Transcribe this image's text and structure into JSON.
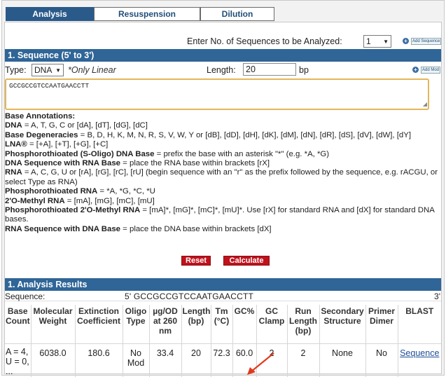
{
  "tabs": [
    {
      "label": "Analysis"
    },
    {
      "label": "Resuspension"
    },
    {
      "label": "Dilution"
    }
  ],
  "seq_count": {
    "label": "Enter No. of Sequences to be Analyzed:",
    "value": "1",
    "add_label": "Add Sequence"
  },
  "section1": {
    "title": "1. Sequence (5' to 3')"
  },
  "type_row": {
    "label": "Type:",
    "value": "DNA",
    "note": "*Only Linear",
    "length_label": "Length:",
    "length_value": "20",
    "unit": "bp",
    "add_mod_label": "Add Mod"
  },
  "sequence_input": "GCCGCCGTCCAATGAACCTT",
  "annotations": {
    "base_title": "Base Annotations:",
    "dna_k": "DNA",
    "dna_v": " = A, T, G, C or [dA], [dT], [dG], [dC]",
    "degen_k": "Base Degeneracies",
    "degen_v": " = B, D, H, K, M, N, R, S, V, W, Y or [dB], [dD], [dH], [dK], [dM], [dN], [dR], [dS], [dV], [dW], [dY]",
    "lna_k": "LNA®",
    "lna_v": " = [+A], [+T], [+G], [+C]",
    "ps_k": "Phosphorothioated (S-Oligo) DNA Base",
    "ps_v": " = prefix the base with an asterisk \"*\" (e.g. *A, *G)",
    "dnarna_k": "DNA Sequence with RNA Base",
    "dnarna_v": " = place the RNA base within brackets [rX]",
    "rna_k": "RNA",
    "rna_v": " = A, C, G, U or [rA], [rG], [rC], [rU] (begin sequence with an \"r\" as the prefix followed by the sequence, e.g. rACGU, or select Type as RNA)",
    "psrna_k": "Phosphorothioated RNA",
    "psrna_v": " = *A, *G, *C, *U",
    "ome_k": "2'O-Methyl RNA",
    "ome_v": " = [mA], [mG], [mC], [mU]",
    "psome_k": "Phosphorothioated 2'O-Methyl RNA",
    "psome_v": " = [mA]*, [mG]*, [mC]*, [mU]*. Use [rX] for standard RNA and [dX] for standard DNA bases.",
    "rnadna_k": "RNA Sequence with DNA Base",
    "rnadna_v": " = place the DNA base within brackets [dX]"
  },
  "buttons": {
    "reset": "Reset",
    "calculate": "Calculate"
  },
  "section2": {
    "title": "1. Analysis Results"
  },
  "results": {
    "seq_label": "Sequence:",
    "seq_value": "5' GCCGCCGTCCAATGAACCTT",
    "seq_end": "3'",
    "headers": [
      "Base Count",
      "Molecular Weight",
      "Extinction Coefficient",
      "Oligo Type",
      "µg/OD at 260 nm",
      "Length (bp)",
      "Tm (°C)",
      "GC%",
      "GC Clamp",
      "Run Length (bp)",
      "Secondary Structure",
      "Primer Dimer",
      "BLAST"
    ],
    "row": [
      "A = 4, U = 0, ...",
      "6038.0",
      "180.6",
      "No Mod",
      "33.4",
      "20",
      "72.3",
      "60.0",
      "2",
      "2",
      "None",
      "No",
      "Sequence"
    ]
  },
  "colors": {
    "header_bar": "#2f6597",
    "button_red": "#c0121c",
    "highlight_border": "#e3b65a",
    "arrow": "#e03a1e"
  }
}
